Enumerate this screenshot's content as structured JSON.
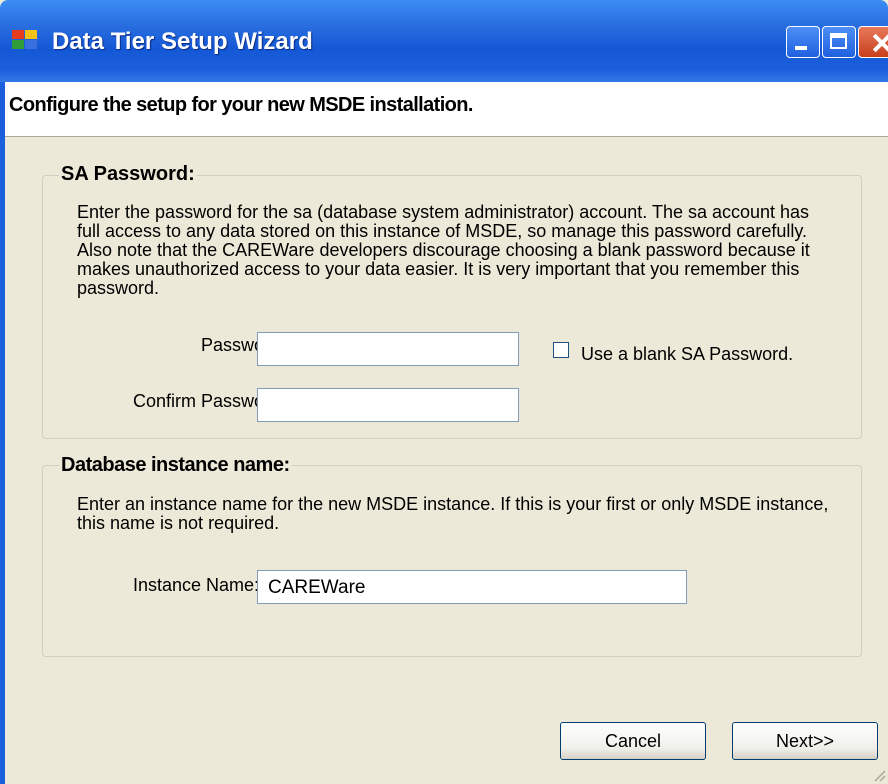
{
  "window": {
    "title": "Data Tier Setup Wizard",
    "titlebar_color": "#1458d6"
  },
  "header": {
    "text": "Configure the setup for your new MSDE installation."
  },
  "sa_group": {
    "legend": "SA Password:",
    "description": "Enter the password for the sa (database system administrator) account. The sa account has full access to any data stored on this instance of MSDE, so manage this password carefully. Also note that the CAREWare developers discourage choosing a blank password because it makes unauthorized access to your data easier. It is very important that you remember this password.",
    "password_label": "Password:",
    "password_value": "",
    "confirm_label": "Confirm Password:",
    "confirm_value": "",
    "blank_checkbox_label": "Use a blank SA Password.",
    "blank_checkbox_checked": false
  },
  "db_group": {
    "legend": "Database instance name:",
    "description": "Enter an instance name for the new MSDE instance. If this is your first or only MSDE instance, this name is not required.",
    "instance_label": "Instance Name:",
    "instance_value": "CAREWare"
  },
  "buttons": {
    "cancel": "Cancel",
    "next": "Next>>"
  }
}
